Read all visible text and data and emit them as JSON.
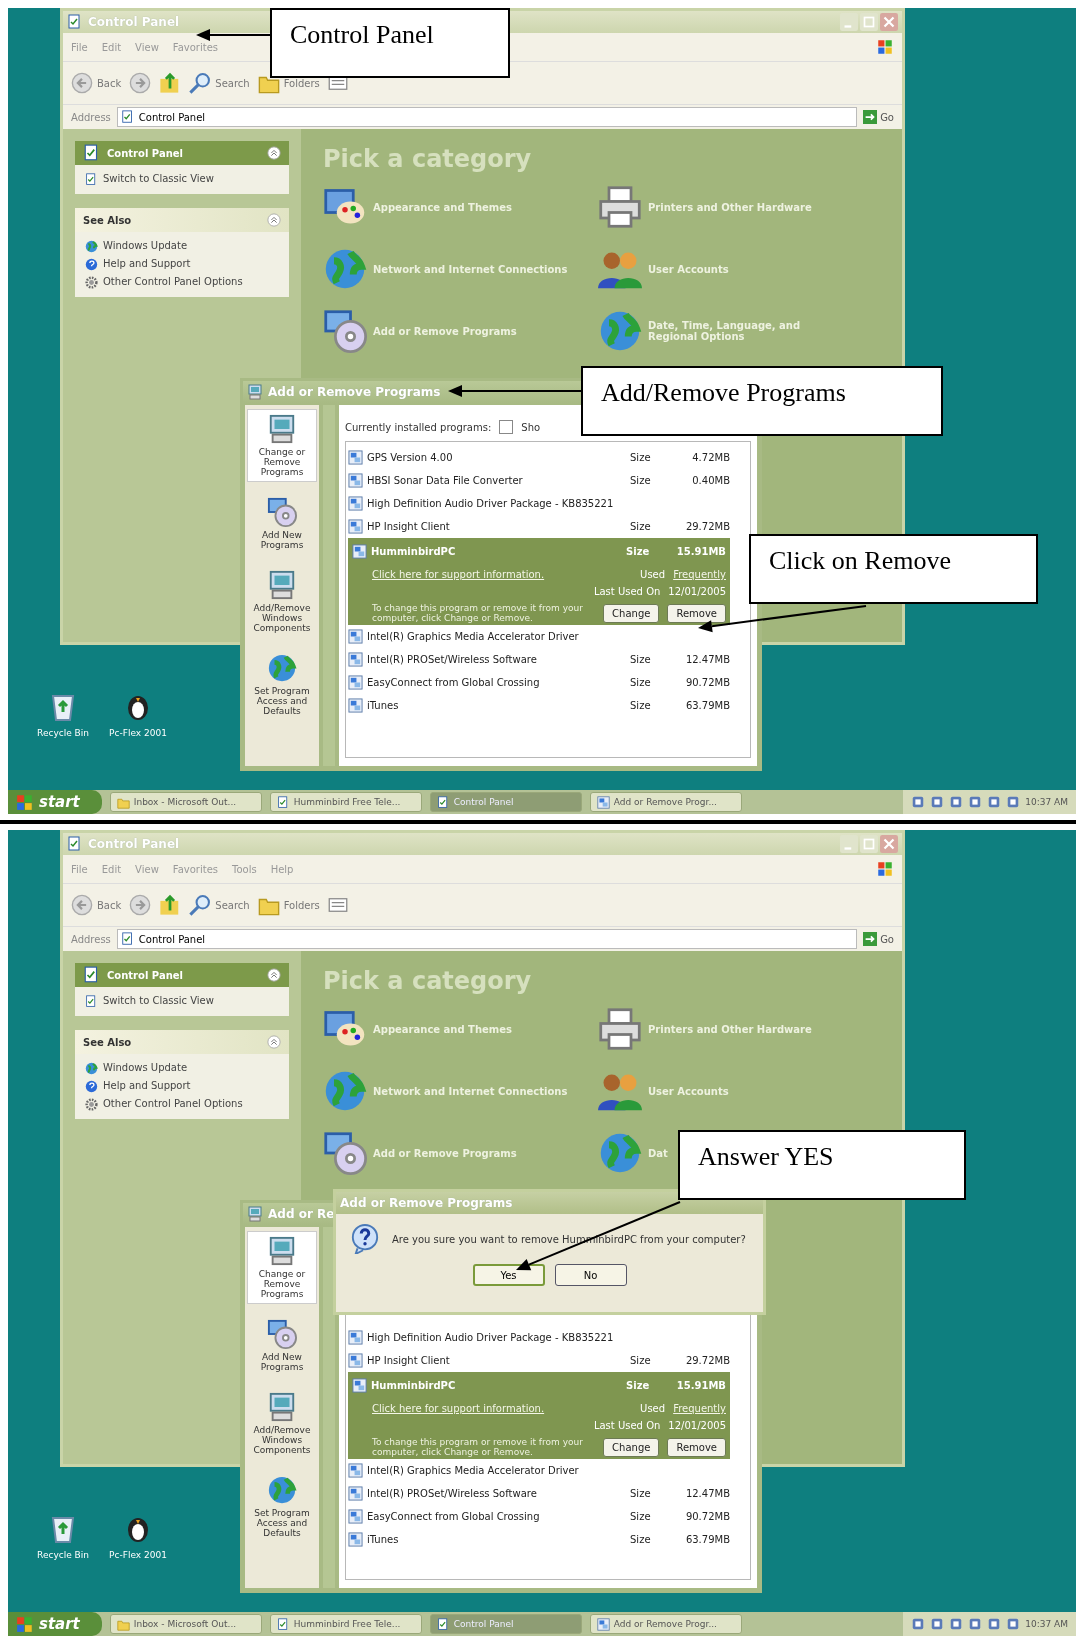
{
  "screens": [
    {
      "control_panel": {
        "title": "Control Panel",
        "menu": [
          "File",
          "Edit",
          "View",
          "Favorites"
        ],
        "toolbar": {
          "back": "Back",
          "search": "Search",
          "folders": "Folders"
        },
        "address": {
          "label": "Address",
          "value": "Control Panel",
          "go": "Go"
        },
        "task_pane": {
          "title": "Control Panel",
          "items": [
            "Switch to Classic View"
          ]
        },
        "see_also": {
          "title": "See Also",
          "items": [
            "Windows Update",
            "Help and Support",
            "Other Control Panel Options"
          ]
        },
        "heading": "Pick a category",
        "categories": [
          "Appearance and Themes",
          "Printers and Other Hardware",
          "Network and Internet Connections",
          "User Accounts",
          "Add or Remove Programs",
          "Date, Time, Language, and Regional Options"
        ]
      },
      "add_remove": {
        "title": "Add or Remove Programs",
        "sidebar": [
          {
            "label": "Change or Remove Programs",
            "selected": true
          },
          {
            "label": "Add New Programs",
            "selected": false
          },
          {
            "label": "Add/Remove Windows Components",
            "selected": false
          },
          {
            "label": "Set Program Access and Defaults",
            "selected": false
          }
        ],
        "header": {
          "label": "Currently installed programs:",
          "checkbox_label": "Sho",
          "checked": false
        },
        "rows": [
          {
            "name": "GPS Version 4.00",
            "size_label": "Size",
            "size": "4.72MB",
            "selected": false
          },
          {
            "name": "HBSI Sonar Data File Converter",
            "size_label": "Size",
            "size": "0.40MB",
            "selected": false
          },
          {
            "name": "High Definition Audio Driver Package - KB835221",
            "selected": false
          },
          {
            "name": "HP Insight Client",
            "size_label": "Size",
            "size": "29.72MB",
            "selected": false
          },
          {
            "name": "HumminbirdPC",
            "size_label": "Size",
            "size": "15.91MB",
            "selected": true,
            "details": {
              "support_link": "Click here for support information.",
              "used_label": "Used",
              "used_value": "Frequently",
              "last_used_label": "Last Used On",
              "last_used_value": "12/01/2005",
              "hint": "To change this program or remove it from your computer, click Change or Remove.",
              "buttons": [
                "Change",
                "Remove"
              ]
            }
          },
          {
            "name": "Intel(R) Graphics Media Accelerator Driver",
            "selected": false
          },
          {
            "name": "Intel(R) PROSet/Wireless Software",
            "size_label": "Size",
            "size": "12.47MB",
            "selected": false
          },
          {
            "name": "EasyConnect from Global Crossing",
            "size_label": "Size",
            "size": "90.72MB",
            "selected": false
          },
          {
            "name": "iTunes",
            "size_label": "Size",
            "size": "63.79MB",
            "selected": false
          }
        ]
      },
      "desktop_icons": [
        "Recycle Bin",
        "Pc-Flex 2001"
      ],
      "taskbar": {
        "start": "start",
        "tasks": [
          {
            "label": "Inbox - Microsoft Out...",
            "selected": false
          },
          {
            "label": "Humminbird Free Tele...",
            "selected": false
          },
          {
            "label": "Control Panel",
            "selected": true
          },
          {
            "label": "Add or Remove Progr...",
            "selected": false
          }
        ],
        "clock": "10:37 AM"
      },
      "callouts": [
        "Control Panel",
        "Add/Remove Programs",
        "Click on Remove"
      ]
    },
    {
      "control_panel": {
        "title": "Control Panel",
        "menu": [
          "File",
          "Edit",
          "View",
          "Favorites",
          "Tools",
          "Help"
        ],
        "toolbar": {
          "back": "Back",
          "search": "Search",
          "folders": "Folders"
        },
        "address": {
          "label": "Address",
          "value": "Control Panel",
          "go": "Go"
        },
        "task_pane": {
          "title": "Control Panel",
          "items": [
            "Switch to Classic View"
          ]
        },
        "see_also": {
          "title": "See Also",
          "items": [
            "Windows Update",
            "Help and Support",
            "Other Control Panel Options"
          ]
        },
        "heading": "Pick a category",
        "categories": [
          "Appearance and Themes",
          "Printers and Other Hardware",
          "Network and Internet Connections",
          "User Accounts",
          "Add or Remove Programs",
          "Dat"
        ]
      },
      "add_remove": {
        "title": "Add or Re",
        "sidebar": [
          {
            "label": "Change or Remove Programs",
            "selected": true
          },
          {
            "label": "Add New Programs",
            "selected": false
          },
          {
            "label": "Add/Remove Windows Components",
            "selected": false
          },
          {
            "label": "Set Program Access and Defaults",
            "selected": false
          }
        ],
        "rows": [
          {
            "name": "High Definition Audio Driver Package - KB835221",
            "selected": false
          },
          {
            "name": "HP Insight Client",
            "size_label": "Size",
            "size": "29.72MB",
            "selected": false
          },
          {
            "name": "HumminbirdPC",
            "size_label": "Size",
            "size": "15.91MB",
            "selected": true,
            "details": {
              "support_link": "Click here for support information.",
              "used_label": "Used",
              "used_value": "Frequently",
              "last_used_label": "Last Used On",
              "last_used_value": "12/01/2005",
              "hint": "To change this program or remove it from your computer, click Change or Remove.",
              "buttons": [
                "Change",
                "Remove"
              ]
            }
          },
          {
            "name": "Intel(R) Graphics Media Accelerator Driver",
            "selected": false
          },
          {
            "name": "Intel(R) PROSet/Wireless Software",
            "size_label": "Size",
            "size": "12.47MB",
            "selected": false
          },
          {
            "name": "EasyConnect from Global Crossing",
            "size_label": "Size",
            "size": "90.72MB",
            "selected": false
          },
          {
            "name": "iTunes",
            "size_label": "Size",
            "size": "63.79MB",
            "selected": false
          }
        ]
      },
      "dialog": {
        "title": "Add or Remove Programs",
        "message": "Are you sure you want to remove HumminbirdPC from your computer?",
        "buttons": [
          {
            "label": "Yes",
            "selected": true
          },
          {
            "label": "No",
            "selected": false
          }
        ]
      },
      "desktop_icons": [
        "Recycle Bin",
        "Pc-Flex 2001"
      ],
      "taskbar": {
        "start": "start",
        "tasks": [
          {
            "label": "Inbox - Microsoft Out...",
            "selected": false
          },
          {
            "label": "Humminbird Free Tele...",
            "selected": false
          },
          {
            "label": "Control Panel",
            "selected": true
          },
          {
            "label": "Add or Remove Progr...",
            "selected": false
          }
        ],
        "clock": "10:37 AM"
      },
      "callouts": [
        "Answer YES"
      ]
    }
  ]
}
